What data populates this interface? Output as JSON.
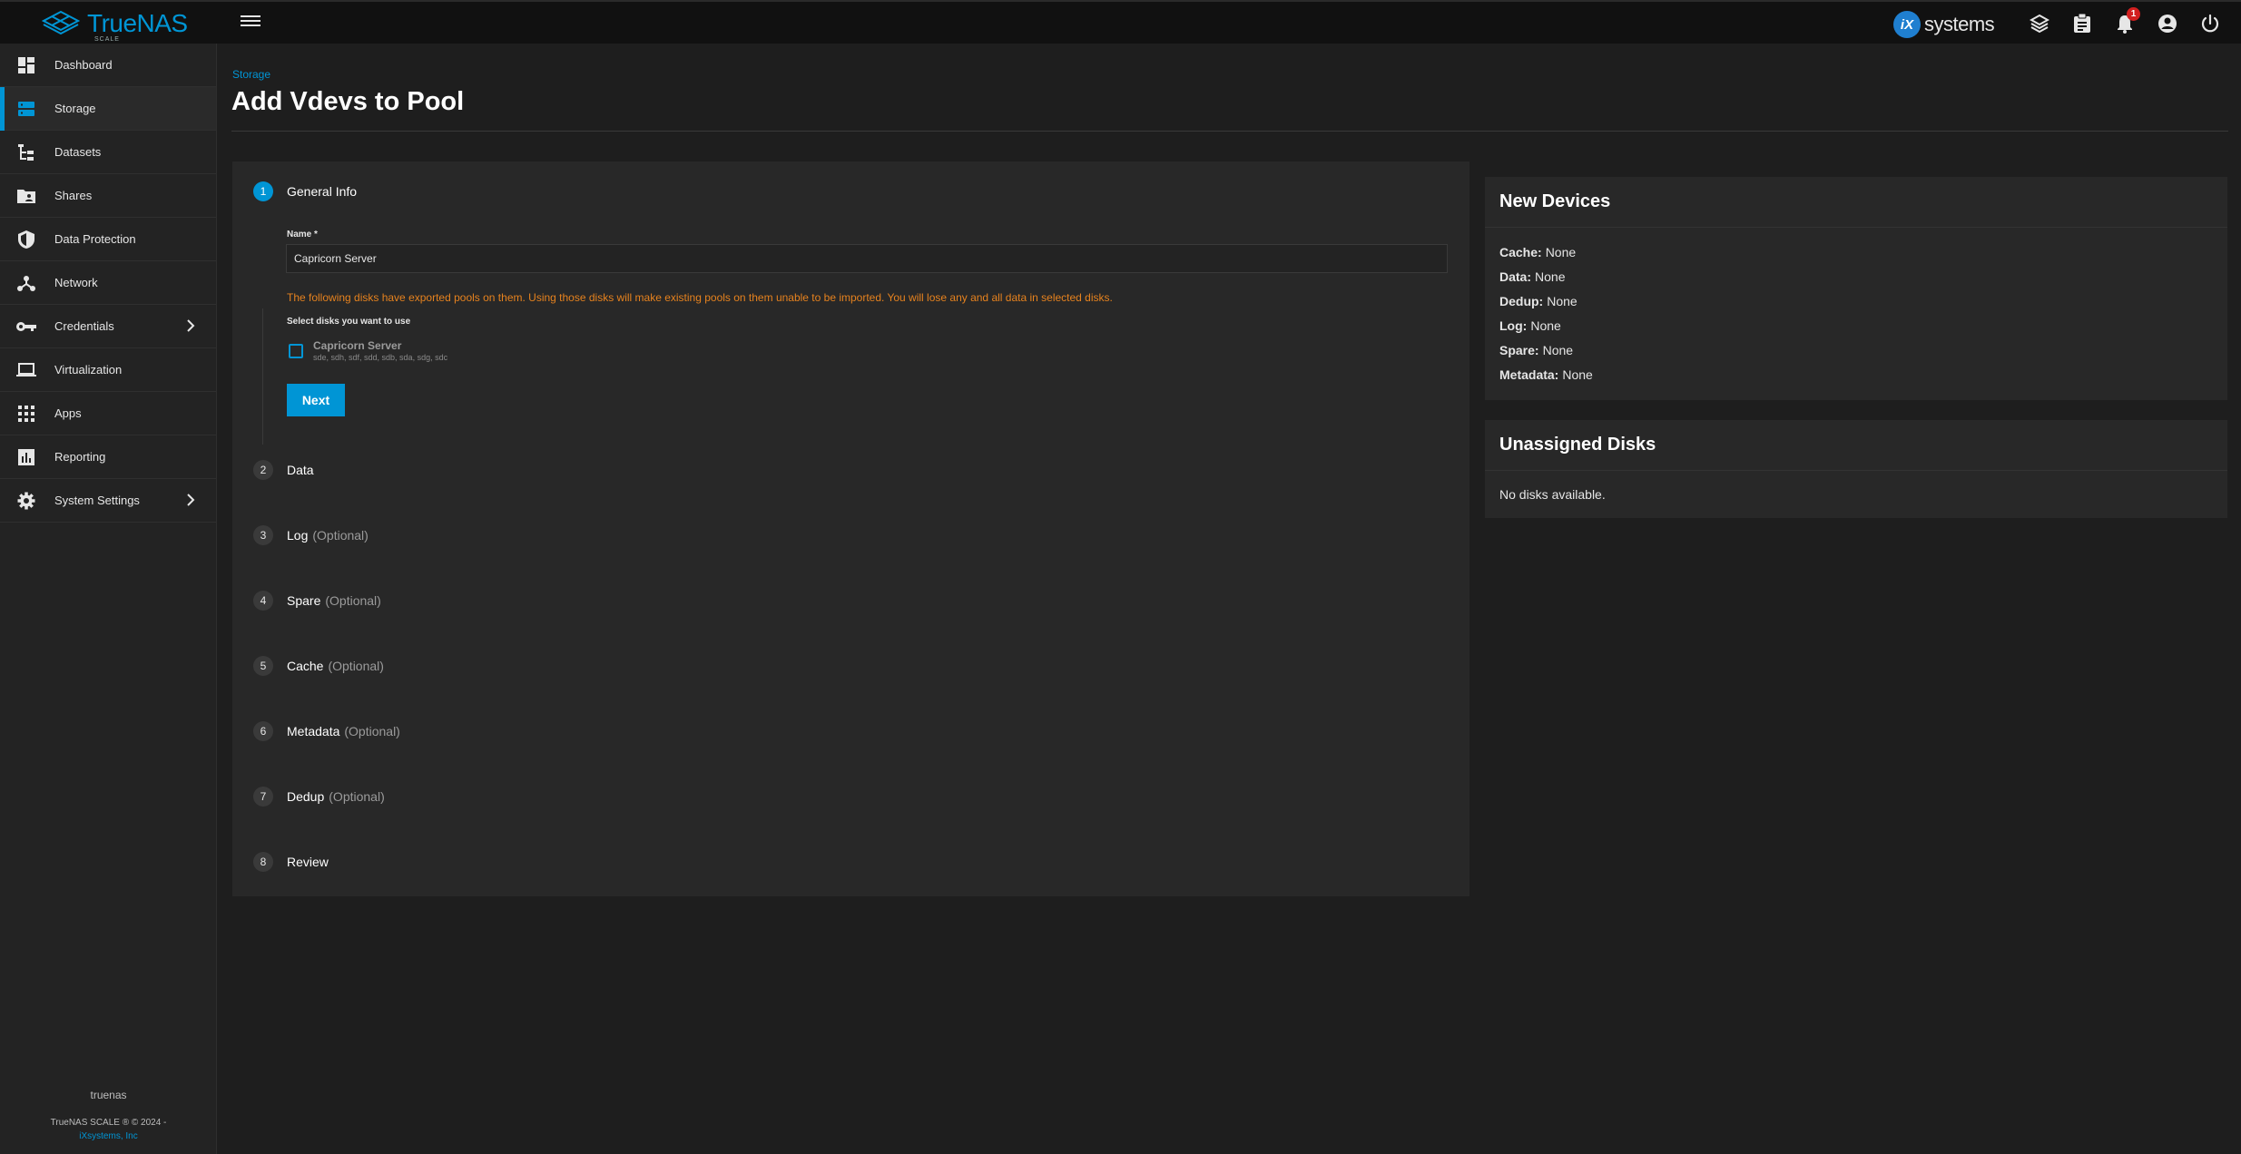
{
  "app": {
    "logo_text": "TrueNAS",
    "logo_sub": "SCALE",
    "vendor_logo": "iX",
    "vendor_text": "systems",
    "notification_count": "1",
    "accent_color": "#0095d5",
    "warning_color": "#e6821e"
  },
  "topbar_icons": [
    "menu-icon",
    "truecommand-icon",
    "jobs-icon",
    "bell-icon",
    "account-icon",
    "power-icon"
  ],
  "sidebar": {
    "items": [
      {
        "label": "Dashboard",
        "icon": "dashboard-icon"
      },
      {
        "label": "Storage",
        "icon": "storage-icon"
      },
      {
        "label": "Datasets",
        "icon": "datasets-icon"
      },
      {
        "label": "Shares",
        "icon": "shares-icon"
      },
      {
        "label": "Data Protection",
        "icon": "shield-icon"
      },
      {
        "label": "Network",
        "icon": "network-icon"
      },
      {
        "label": "Credentials",
        "icon": "key-icon"
      },
      {
        "label": "Virtualization",
        "icon": "laptop-icon"
      },
      {
        "label": "Apps",
        "icon": "apps-grid-icon"
      },
      {
        "label": "Reporting",
        "icon": "chart-icon"
      },
      {
        "label": "System Settings",
        "icon": "gear-icon"
      }
    ],
    "hostname": "truenas",
    "copyright": "TrueNAS SCALE ® © 2024 -",
    "company": "iXsystems, Inc"
  },
  "page": {
    "breadcrumb": "Storage",
    "title": "Add Vdevs to Pool"
  },
  "wizard": {
    "steps": [
      {
        "num": "1",
        "label": "General Info",
        "optional": ""
      },
      {
        "num": "2",
        "label": "Data",
        "optional": ""
      },
      {
        "num": "3",
        "label": "Log",
        "optional": "(Optional)"
      },
      {
        "num": "4",
        "label": "Spare",
        "optional": "(Optional)"
      },
      {
        "num": "5",
        "label": "Cache",
        "optional": "(Optional)"
      },
      {
        "num": "6",
        "label": "Metadata",
        "optional": "(Optional)"
      },
      {
        "num": "7",
        "label": "Dedup",
        "optional": "(Optional)"
      },
      {
        "num": "8",
        "label": "Review",
        "optional": ""
      }
    ],
    "name_label": "Name *",
    "name_value": "Capricorn Server",
    "warning": "The following disks have exported pools on them. Using those disks will make existing pools on them unable to be imported. You will lose any and all data in selected disks.",
    "select_label": "Select disks you want to use",
    "pool_name": "Capricorn Server",
    "pool_disks": "sde, sdh, sdf, sdd, sdb, sda, sdg, sdc",
    "next_label": "Next"
  },
  "new_devices": {
    "title": "New Devices",
    "rows": [
      {
        "key": "Cache:",
        "value": "None"
      },
      {
        "key": "Data:",
        "value": "None"
      },
      {
        "key": "Dedup:",
        "value": "None"
      },
      {
        "key": "Log:",
        "value": "None"
      },
      {
        "key": "Spare:",
        "value": "None"
      },
      {
        "key": "Metadata:",
        "value": "None"
      }
    ]
  },
  "unassigned": {
    "title": "Unassigned Disks",
    "message": "No disks available."
  }
}
